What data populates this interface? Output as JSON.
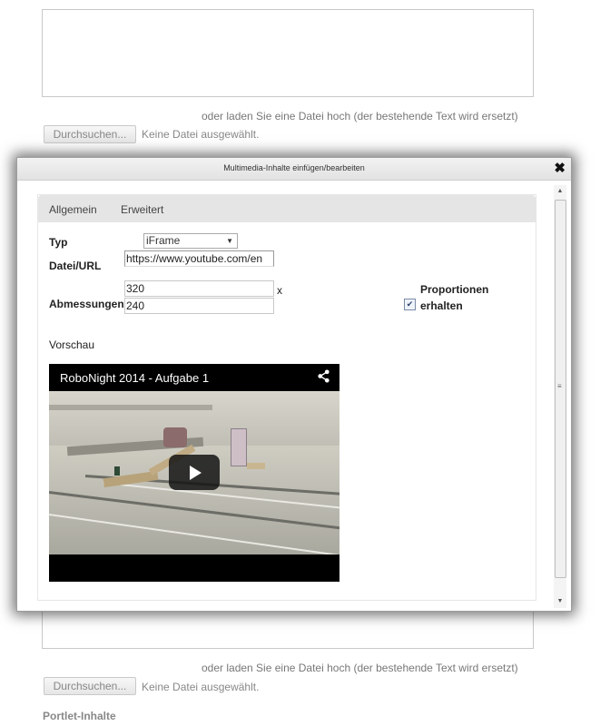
{
  "page": {
    "hint_text": "oder laden Sie eine Datei hoch (der bestehende Text wird ersetzt)",
    "browse_button": "Durchsuchen...",
    "no_file_text": "Keine Datei ausgewählt.",
    "portlet_label": "Portlet-Inhalte"
  },
  "dialog": {
    "title": "Multimedia-Inhalte einfügen/bearbeiten",
    "close_glyph": "✖",
    "tabs": [
      {
        "label": "Allgemein"
      },
      {
        "label": "Erweitert"
      }
    ],
    "form": {
      "type_label": "Typ",
      "type_value": "iFrame",
      "url_label": "Datei/URL",
      "url_value": "https://www.youtube.com/en",
      "dimensions_label": "Abmessungen",
      "width_value": "320",
      "height_value": "240",
      "separator": "x",
      "proportions_label_1": "Proportionen",
      "proportions_label_2": "erhalten",
      "proportions_checked": true,
      "preview_label": "Vorschau"
    },
    "video": {
      "title": "RoboNight 2014 - Aufgabe 1",
      "share_icon": "share-icon",
      "play_icon": "play-icon"
    }
  },
  "colors": {
    "dialog_border": "#9e9e9e",
    "tabbar_bg": "#e5e5e5",
    "hint_text": "#777777"
  }
}
